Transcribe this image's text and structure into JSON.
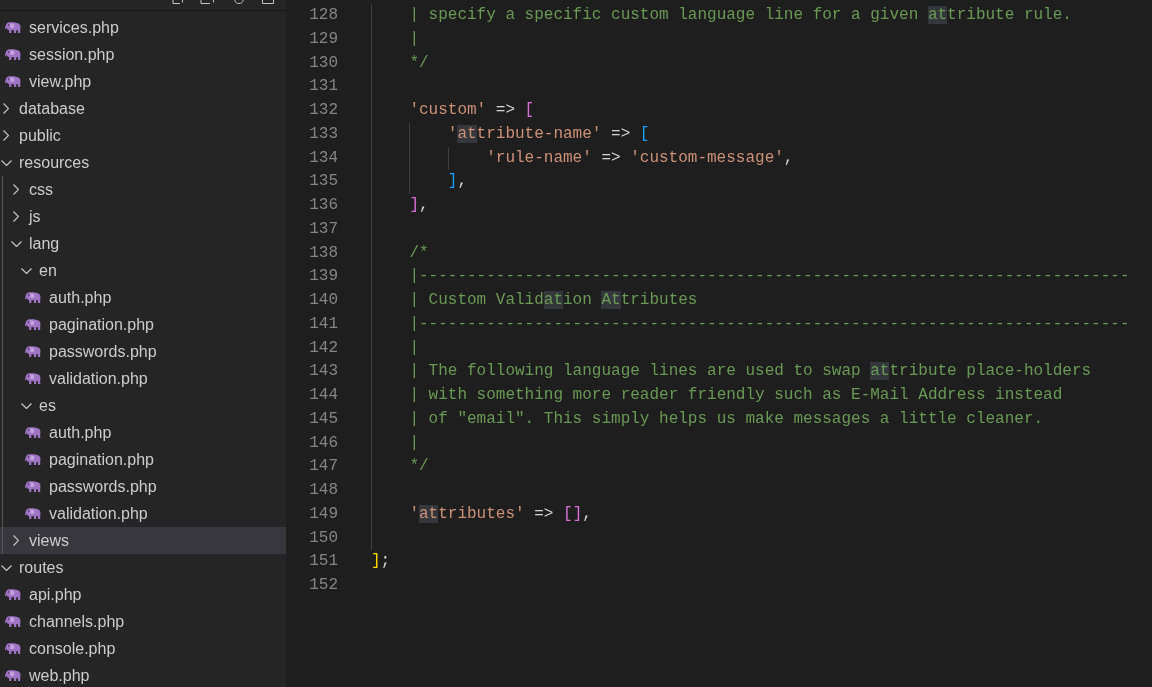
{
  "explorer": {
    "tree": [
      {
        "kind": "continued",
        "children": [
          {
            "kind": "file",
            "name": "services.php",
            "selected": false
          },
          {
            "kind": "file",
            "name": "session.php",
            "selected": false
          },
          {
            "kind": "file",
            "name": "view.php",
            "selected": false
          }
        ]
      },
      {
        "kind": "folder",
        "name": "database",
        "expanded": false,
        "selected": false
      },
      {
        "kind": "folder",
        "name": "public",
        "expanded": false,
        "selected": false
      },
      {
        "kind": "folder",
        "name": "resources",
        "expanded": true,
        "selected": false,
        "children": [
          {
            "kind": "folder",
            "name": "css",
            "expanded": false,
            "selected": false
          },
          {
            "kind": "folder",
            "name": "js",
            "expanded": false,
            "selected": false
          },
          {
            "kind": "folder",
            "name": "lang",
            "expanded": true,
            "selected": false,
            "children": [
              {
                "kind": "folder",
                "name": "en",
                "expanded": true,
                "selected": false,
                "children": [
                  {
                    "kind": "file",
                    "name": "auth.php",
                    "selected": false
                  },
                  {
                    "kind": "file",
                    "name": "pagination.php",
                    "selected": false
                  },
                  {
                    "kind": "file",
                    "name": "passwords.php",
                    "selected": false
                  },
                  {
                    "kind": "file",
                    "name": "validation.php",
                    "selected": false
                  }
                ]
              },
              {
                "kind": "folder",
                "name": "es",
                "expanded": true,
                "selected": false,
                "children": [
                  {
                    "kind": "file",
                    "name": "auth.php",
                    "selected": false
                  },
                  {
                    "kind": "file",
                    "name": "pagination.php",
                    "selected": false
                  },
                  {
                    "kind": "file",
                    "name": "passwords.php",
                    "selected": false
                  },
                  {
                    "kind": "file",
                    "name": "validation.php",
                    "selected": false
                  }
                ]
              }
            ]
          },
          {
            "kind": "folder",
            "name": "views",
            "expanded": false,
            "selected": true
          }
        ]
      },
      {
        "kind": "folder",
        "name": "routes",
        "expanded": true,
        "selected": false,
        "children": [
          {
            "kind": "file",
            "name": "api.php",
            "selected": false
          },
          {
            "kind": "file",
            "name": "channels.php",
            "selected": false
          },
          {
            "kind": "file",
            "name": "console.php",
            "selected": false
          },
          {
            "kind": "file",
            "name": "web.php",
            "selected": false
          }
        ]
      }
    ]
  },
  "editor": {
    "lines": [
      {
        "number": "128",
        "tokens": [
          {
            "kind": "comment",
            "text": "    | specify a specific custom language line for a given ",
            "match": false
          },
          {
            "kind": "comment",
            "text": "at",
            "match": true
          },
          {
            "kind": "comment",
            "text": "tribute rule.",
            "match": false
          }
        ]
      },
      {
        "number": "129",
        "tokens": [
          {
            "kind": "comment",
            "text": "    |",
            "match": false
          }
        ]
      },
      {
        "number": "130",
        "tokens": [
          {
            "kind": "comment",
            "text": "    */",
            "match": false
          }
        ]
      },
      {
        "number": "131"
      },
      {
        "number": "132",
        "tokens": [
          {
            "kind": "string",
            "text": "    'custom'",
            "match": false
          },
          {
            "kind": "operator",
            "text": " => ",
            "match": false
          },
          {
            "kind": "bracket-pink",
            "text": "[",
            "match": false
          }
        ]
      },
      {
        "number": "133",
        "tokens": [
          {
            "kind": "string",
            "text": "        '",
            "match": false
          },
          {
            "kind": "string",
            "text": "at",
            "match": true
          },
          {
            "kind": "string",
            "text": "tribute-name'",
            "match": false
          },
          {
            "kind": "operator",
            "text": " => ",
            "match": false
          },
          {
            "kind": "bracket-blue",
            "text": "[",
            "match": false
          }
        ]
      },
      {
        "number": "134",
        "tokens": [
          {
            "kind": "string",
            "text": "            'rule-name'",
            "match": false
          },
          {
            "kind": "operator",
            "text": " => ",
            "match": false
          },
          {
            "kind": "string",
            "text": "'custom-message'",
            "match": false
          },
          {
            "kind": "punctuation",
            "text": ",",
            "match": false
          }
        ]
      },
      {
        "number": "135",
        "tokens": [
          {
            "kind": "bracket-blue",
            "text": "        ]",
            "match": false
          },
          {
            "kind": "punctuation",
            "text": ",",
            "match": false
          }
        ]
      },
      {
        "number": "136",
        "tokens": [
          {
            "kind": "bracket-pink",
            "text": "    ]",
            "match": false
          },
          {
            "kind": "punctuation",
            "text": ",",
            "match": false
          }
        ]
      },
      {
        "number": "137"
      },
      {
        "number": "138",
        "tokens": [
          {
            "kind": "comment",
            "text": "    /*",
            "match": false
          }
        ]
      },
      {
        "number": "139",
        "tokens": [
          {
            "kind": "comment",
            "text": "    |--------------------------------------------------------------------------",
            "match": false
          }
        ]
      },
      {
        "number": "140",
        "tokens": [
          {
            "kind": "comment",
            "text": "    | Custom Valid",
            "match": false
          },
          {
            "kind": "comment",
            "text": "at",
            "match": true
          },
          {
            "kind": "comment",
            "text": "ion ",
            "match": false
          },
          {
            "kind": "comment",
            "text": "At",
            "match": true
          },
          {
            "kind": "comment",
            "text": "tributes",
            "match": false
          }
        ]
      },
      {
        "number": "141",
        "tokens": [
          {
            "kind": "comment",
            "text": "    |--------------------------------------------------------------------------",
            "match": false
          }
        ]
      },
      {
        "number": "142",
        "tokens": [
          {
            "kind": "comment",
            "text": "    |",
            "match": false
          }
        ]
      },
      {
        "number": "143",
        "tokens": [
          {
            "kind": "comment",
            "text": "    | The following language lines are used to swap ",
            "match": false
          },
          {
            "kind": "comment",
            "text": "at",
            "match": true
          },
          {
            "kind": "comment",
            "text": "tribute place-holders",
            "match": false
          }
        ]
      },
      {
        "number": "144",
        "tokens": [
          {
            "kind": "comment",
            "text": "    | with something more reader friendly such as E-Mail Address instead",
            "match": false
          }
        ]
      },
      {
        "number": "145",
        "tokens": [
          {
            "kind": "comment",
            "text": "    | of \"email\". This simply helps us make messages a little cleaner.",
            "match": false
          }
        ]
      },
      {
        "number": "146",
        "tokens": [
          {
            "kind": "comment",
            "text": "    |",
            "match": false
          }
        ]
      },
      {
        "number": "147",
        "tokens": [
          {
            "kind": "comment",
            "text": "    */",
            "match": false
          }
        ]
      },
      {
        "number": "148"
      },
      {
        "number": "149",
        "tokens": [
          {
            "kind": "string",
            "text": "    '",
            "match": false
          },
          {
            "kind": "string",
            "text": "at",
            "match": true
          },
          {
            "kind": "string",
            "text": "tributes'",
            "match": false
          },
          {
            "kind": "operator",
            "text": " => ",
            "match": false
          },
          {
            "kind": "bracket-pink",
            "text": "[]",
            "match": false
          },
          {
            "kind": "punctuation",
            "text": ",",
            "match": false
          }
        ]
      },
      {
        "number": "150"
      },
      {
        "number": "151",
        "tokens": [
          {
            "kind": "bracket-gold",
            "text": "]",
            "match": false
          },
          {
            "kind": "punctuation",
            "text": ";",
            "match": false
          }
        ]
      },
      {
        "number": "152"
      }
    ]
  }
}
